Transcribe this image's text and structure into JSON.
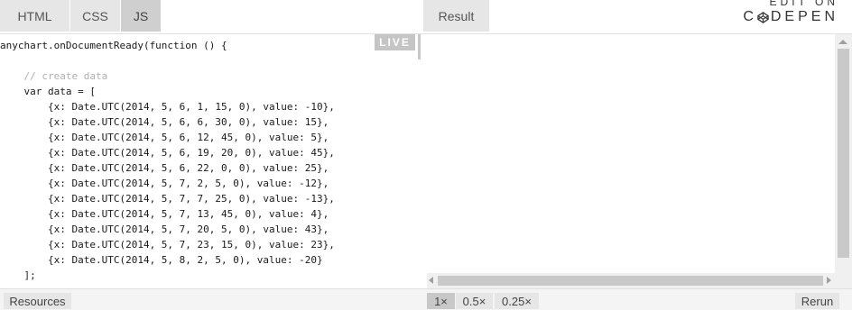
{
  "tabs": {
    "html": "HTML",
    "css": "CSS",
    "js": "JS",
    "result": "Result"
  },
  "brand": {
    "edit_on": "EDIT ON",
    "codepen": "DEPEN",
    "codepen_prefix": "C"
  },
  "editor": {
    "live_badge": "LIVE",
    "lines": [
      "anychart.onDocumentReady(function () {",
      "",
      "    // create data",
      "    var data = [",
      "        {x: Date.UTC(2014, 5, 6, 1, 15, 0), value: -10},",
      "        {x: Date.UTC(2014, 5, 6, 6, 30, 0), value: 15},",
      "        {x: Date.UTC(2014, 5, 6, 12, 45, 0), value: 5},",
      "        {x: Date.UTC(2014, 5, 6, 19, 20, 0), value: 45},",
      "        {x: Date.UTC(2014, 5, 6, 22, 0, 0), value: 25},",
      "        {x: Date.UTC(2014, 5, 7, 2, 5, 0), value: -12},",
      "        {x: Date.UTC(2014, 5, 7, 7, 25, 0), value: -13},",
      "        {x: Date.UTC(2014, 5, 7, 13, 45, 0), value: 4},",
      "        {x: Date.UTC(2014, 5, 7, 20, 5, 0), value: 43},",
      "        {x: Date.UTC(2014, 5, 7, 23, 15, 0), value: 23},",
      "        {x: Date.UTC(2014, 5, 8, 2, 5, 0), value: -20}",
      "    ];"
    ]
  },
  "bottom": {
    "resources": "Resources",
    "zoom_options": [
      "1×",
      "0.5×",
      "0.25×"
    ],
    "rerun": "Rerun"
  }
}
